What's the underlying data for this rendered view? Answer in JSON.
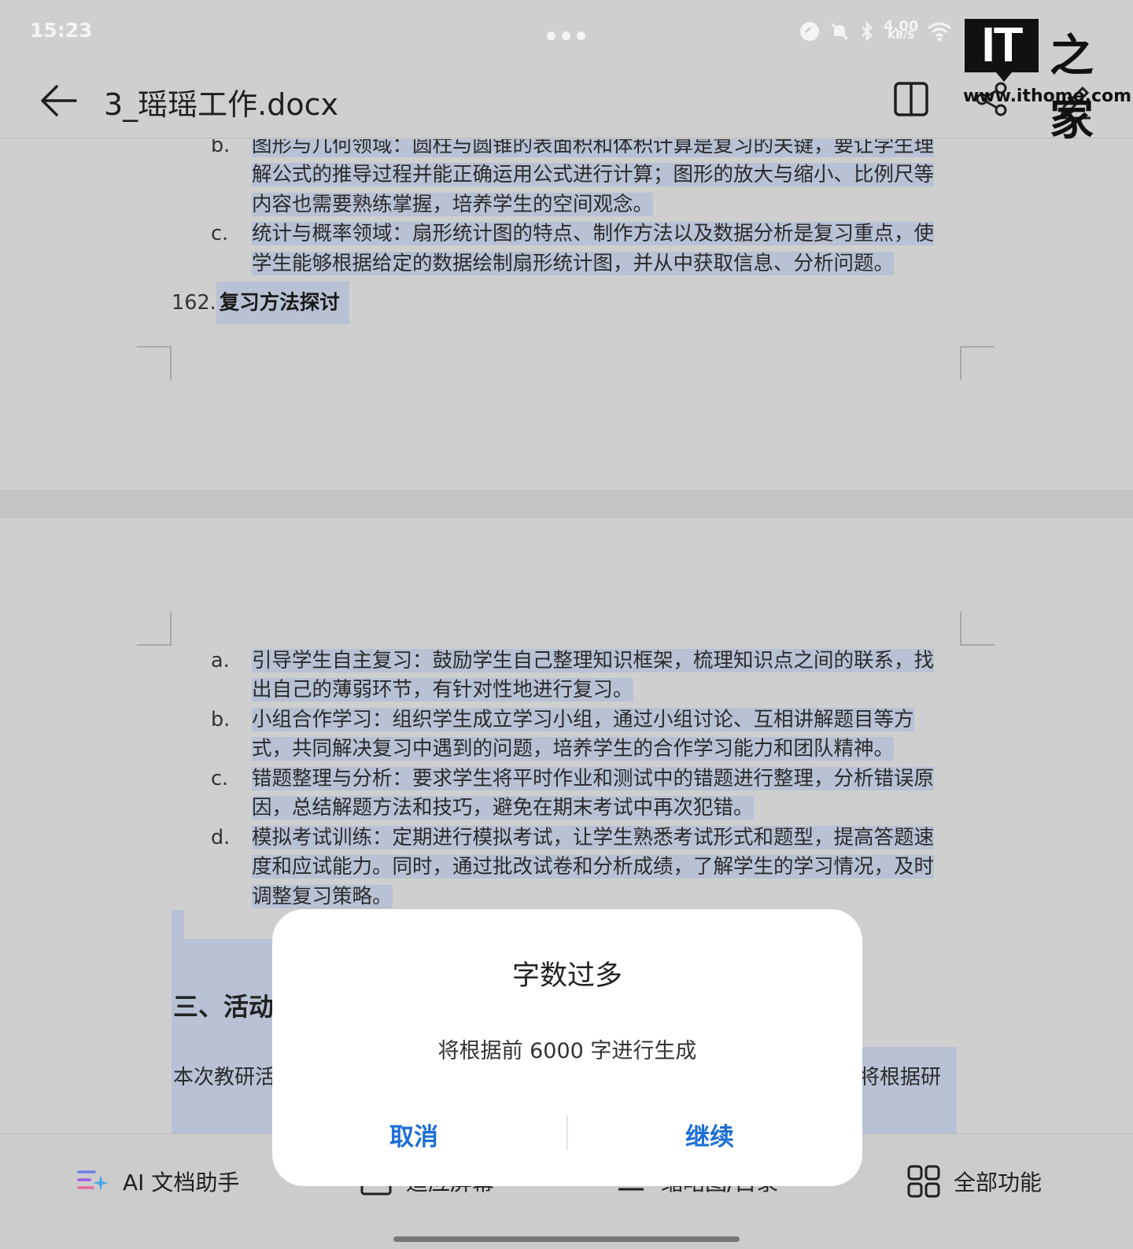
{
  "status": {
    "time": "15:23",
    "net_speed_value": "4.00",
    "net_speed_unit": "KB/S"
  },
  "toolbar": {
    "title": "3_瑶瑶工作.docx"
  },
  "watermark": {
    "logo": "IT",
    "name": "之家",
    "url": "www.ithome.com"
  },
  "document": {
    "page1_items": [
      {
        "marker": "b.",
        "lines": [
          "图形与几何领域：圆柱与圆锥的表面积和体积计算是复习的关键，要让学生理",
          "解公式的推导过程并能正确运用公式进行计算；图形的放大与缩小、比例尺等",
          "内容也需要熟练掌握，培养学生的空间观念。"
        ]
      },
      {
        "marker": "c.",
        "lines": [
          "统计与概率领域：扇形统计图的特点、制作方法以及数据分析是复习重点，使",
          "学生能够根据给定的数据绘制扇形统计图，并从中获取信息、分析问题。"
        ]
      }
    ],
    "heading_162": {
      "number": "162.",
      "text": "复习方法探讨"
    },
    "page2_items": [
      {
        "marker": "a.",
        "lines": [
          "引导学生自主复习：鼓励学生自己整理知识框架，梳理知识点之间的联系，找",
          "出自己的薄弱环节，有针对性地进行复习。"
        ]
      },
      {
        "marker": "b.",
        "lines": [
          "小组合作学习：组织学生成立学习小组，通过小组讨论、互相讲解题目等方",
          "式，共同解决复习中遇到的问题，培养学生的合作学习能力和团队精神。"
        ]
      },
      {
        "marker": "c.",
        "lines": [
          "错题整理与分析：要求学生将平时作业和测试中的错题进行整理，分析错误原",
          "因，总结解题方法和技巧，避免在期末考试中再次犯错。"
        ]
      },
      {
        "marker": "d.",
        "lines": [
          "模拟考试训练：定期进行模拟考试，让学生熟悉考试形式和题型，提高答题速",
          "度和应试能力。同时，通过批改试卷和分析成绩，了解学生的学习情况，及时",
          "调整复习策略。"
        ]
      }
    ],
    "heading_3": "三、活动",
    "para_start": "本次教研活",
    "para_end": "将根据研"
  },
  "bottombar": {
    "ai_label": "AI 文档助手",
    "item2_label": "适应屏幕",
    "item3_label": "缩略图/目录",
    "all_label": "全部功能"
  },
  "dialog": {
    "title": "字数过多",
    "message": "将根据前 6000 字进行生成",
    "cancel": "取消",
    "continue": "继续"
  }
}
